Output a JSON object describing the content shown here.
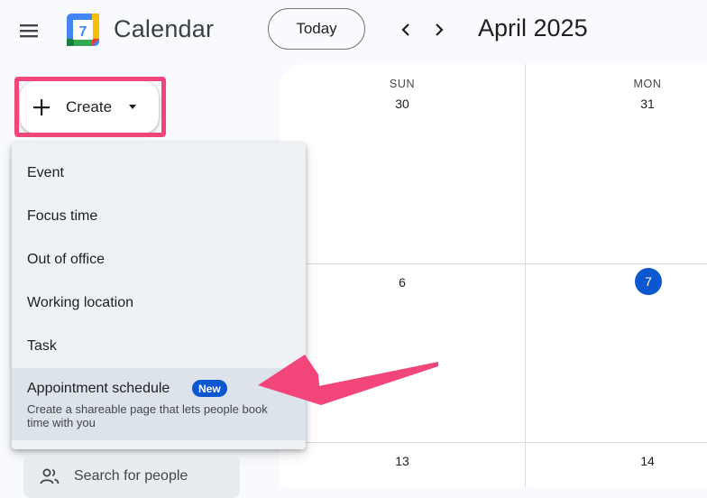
{
  "header": {
    "app_title": "Calendar",
    "logo_number": "7",
    "today_label": "Today",
    "period_title": "April 2025",
    "icons": {
      "menu": "hamburger-menu-icon",
      "prev": "chevron-left-icon",
      "next": "chevron-right-icon"
    }
  },
  "create": {
    "label": "Create",
    "icon": "plus-icon",
    "caret_icon": "caret-down-icon"
  },
  "dropdown": {
    "items": [
      {
        "label": "Event"
      },
      {
        "label": "Focus time"
      },
      {
        "label": "Out of office"
      },
      {
        "label": "Working location"
      },
      {
        "label": "Task"
      }
    ],
    "appointment": {
      "label": "Appointment schedule",
      "badge": "New",
      "description": "Create a shareable page that lets people book time with you"
    }
  },
  "grid": {
    "day_headers": [
      {
        "dow": "SUN",
        "date": "30"
      },
      {
        "dow": "MON",
        "date": "31"
      }
    ],
    "week2": [
      "6",
      "7"
    ],
    "week3": [
      "13",
      "14"
    ],
    "today_date": "7"
  },
  "sidebar": {
    "search_people": "Search for people",
    "people_icon": "people-icon"
  },
  "colors": {
    "highlight": "#f2467b",
    "accent": "#0b57d0",
    "badge": "#0b57d0"
  }
}
